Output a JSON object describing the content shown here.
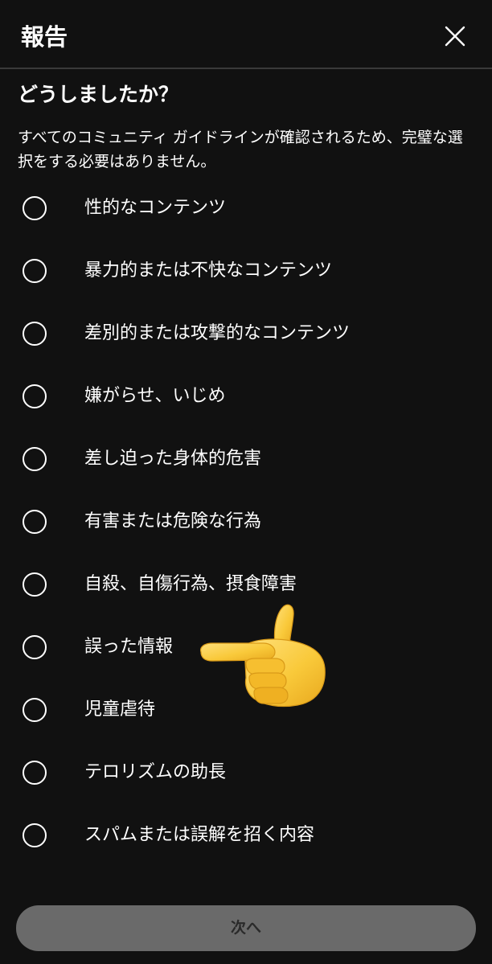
{
  "header": {
    "title": "報告",
    "close_icon": "close-icon"
  },
  "question": "どうしましたか？",
  "description": "すべてのコミュニティ ガイドラインが確認されるため、完璧な選択をする必要はありません。",
  "options": [
    {
      "label": "性的なコンテンツ",
      "selected": false
    },
    {
      "label": "暴力的または不快なコンテンツ",
      "selected": false
    },
    {
      "label": "差別的または攻撃的なコンテンツ",
      "selected": false
    },
    {
      "label": "嫌がらせ、いじめ",
      "selected": false
    },
    {
      "label": "差し迫った身体的危害",
      "selected": false
    },
    {
      "label": "有害または危険な行為",
      "selected": false
    },
    {
      "label": "自殺、自傷行為、摂食障害",
      "selected": false
    },
    {
      "label": "誤った情報",
      "selected": false
    },
    {
      "label": "児童虐待",
      "selected": false
    },
    {
      "label": "テロリズムの助長",
      "selected": false
    },
    {
      "label": "スパムまたは誤解を招く内容",
      "selected": false
    }
  ],
  "pointer_emoji": "pointing-left-hand-icon",
  "next_button": {
    "label": "次へ",
    "enabled": false
  },
  "colors": {
    "background": "#111111",
    "text": "#ffffff",
    "divider": "#3a3a3a",
    "button_disabled_bg": "#6a6a6a",
    "button_disabled_text": "#2a2a2a",
    "emoji_yellow": "#f7c531"
  }
}
